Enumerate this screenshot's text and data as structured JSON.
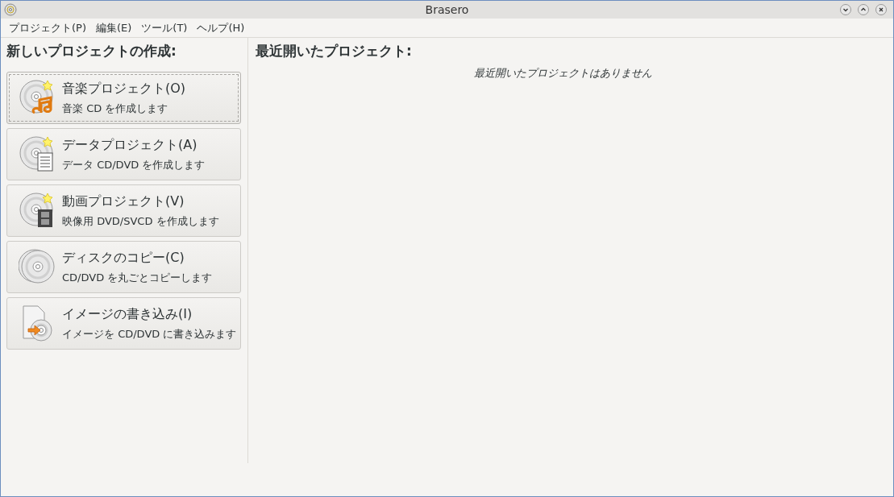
{
  "window": {
    "title": "Brasero"
  },
  "menu": [
    "プロジェクト(P)",
    "編集(E)",
    "ツール(T)",
    "ヘルプ(H)"
  ],
  "new_project": {
    "heading": "新しいプロジェクトの作成:",
    "buttons": [
      {
        "kind": "music",
        "title": "音楽プロジェクト(O)",
        "subtitle": "音楽 CD を作成します",
        "focused": true
      },
      {
        "kind": "data",
        "title": "データプロジェクト(A)",
        "subtitle": "データ CD/DVD を作成します",
        "focused": false
      },
      {
        "kind": "video",
        "title": "動画プロジェクト(V)",
        "subtitle": "映像用 DVD/SVCD を作成します",
        "focused": false
      },
      {
        "kind": "copy",
        "title": "ディスクのコピー(C)",
        "subtitle": "CD/DVD を丸ごとコピーします",
        "focused": false
      },
      {
        "kind": "image",
        "title": "イメージの書き込み(I)",
        "subtitle": "イメージを CD/DVD に書き込みます",
        "focused": false
      }
    ]
  },
  "recent": {
    "heading": "最近開いたプロジェクト:",
    "empty_message": "最近開いたプロジェクトはありません"
  }
}
